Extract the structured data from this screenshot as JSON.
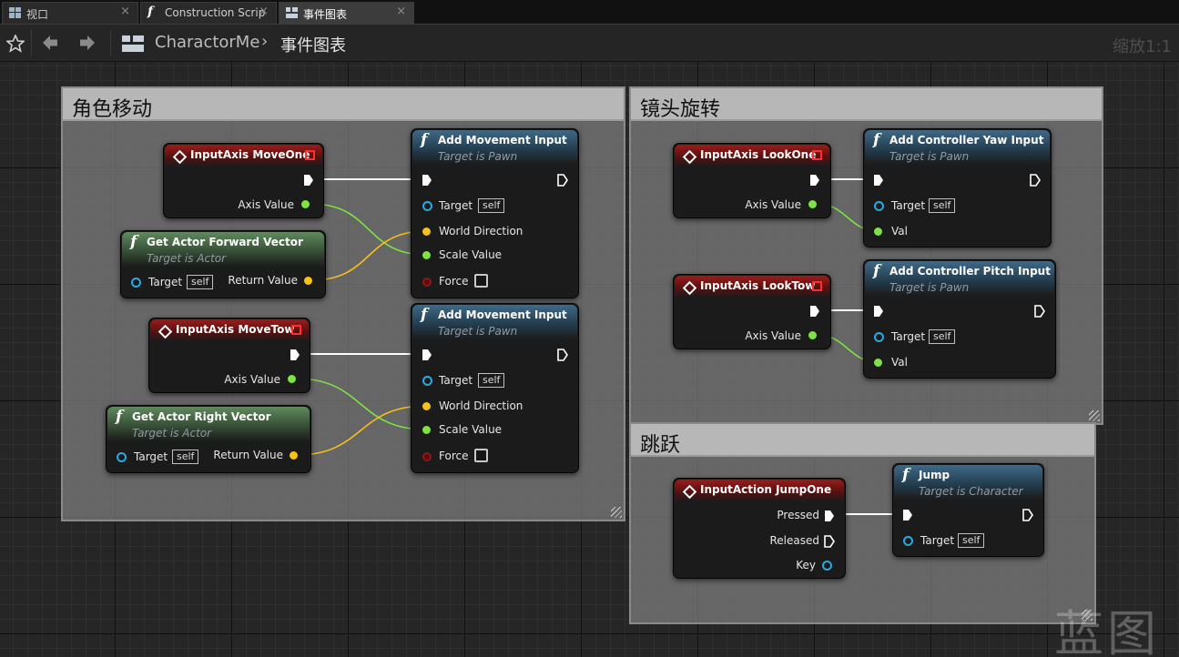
{
  "tabs": [
    {
      "label": "视口",
      "icon": "viewport-icon"
    },
    {
      "label": "Construction Scrip",
      "icon": "function-icon"
    },
    {
      "label": "事件图表",
      "icon": "event-graph-icon"
    }
  ],
  "toolbar": {
    "breadcrumb_root": "CharactorMe",
    "breadcrumb_separator": "›",
    "breadcrumb_current": "事件图表",
    "zoom": "缩放1:1"
  },
  "comments": {
    "move": "角色移动",
    "camera": "镜头旋转",
    "jump": "跳跃"
  },
  "nodes": {
    "axis_moveone": {
      "title": "InputAxis MoveOne",
      "axis_value": "Axis Value"
    },
    "fwd_vector": {
      "title": "Get Actor Forward Vector",
      "subtitle": "Target is Actor",
      "target": "Target",
      "self": "self",
      "return_value": "Return Value"
    },
    "add_move_1": {
      "title": "Add Movement Input",
      "subtitle": "Target is Pawn",
      "target": "Target",
      "self": "self",
      "world_direction": "World Direction",
      "scale_value": "Scale Value",
      "force": "Force"
    },
    "axis_movetow": {
      "title": "InputAxis MoveTow",
      "axis_value": "Axis Value"
    },
    "right_vector": {
      "title": "Get Actor Right Vector",
      "subtitle": "Target is Actor",
      "target": "Target",
      "self": "self",
      "return_value": "Return Value"
    },
    "add_move_2": {
      "title": "Add Movement Input",
      "subtitle": "Target is Pawn",
      "target": "Target",
      "self": "self",
      "world_direction": "World Direction",
      "scale_value": "Scale Value",
      "force": "Force"
    },
    "axis_lookone": {
      "title": "InputAxis LookOne",
      "axis_value": "Axis Value"
    },
    "yaw_input": {
      "title": "Add Controller Yaw Input",
      "subtitle": "Target is Pawn",
      "target": "Target",
      "self": "self",
      "val": "Val"
    },
    "axis_looktow": {
      "title": "InputAxis LookTow",
      "axis_value": "Axis Value"
    },
    "pitch_input": {
      "title": "Add Controller Pitch Input",
      "subtitle": "Target is Pawn",
      "target": "Target",
      "self": "self",
      "val": "Val"
    },
    "action_jumpone": {
      "title": "InputAction JumpOne",
      "pressed": "Pressed",
      "released": "Released",
      "key": "Key"
    },
    "jump": {
      "title": "Jump",
      "subtitle": "Target is Character",
      "target": "Target",
      "self": "self"
    }
  },
  "function_glyph": "f",
  "watermark": "蓝图",
  "colors": {
    "event_header": "#9b1c1c",
    "function_header": "#3e6a88",
    "pure_header": "#5f8a5d",
    "float_pin": "#7ee344",
    "vector_pin": "#f7c01b",
    "object_pin": "#29a9e1",
    "exec_wire": "#ffffff"
  }
}
